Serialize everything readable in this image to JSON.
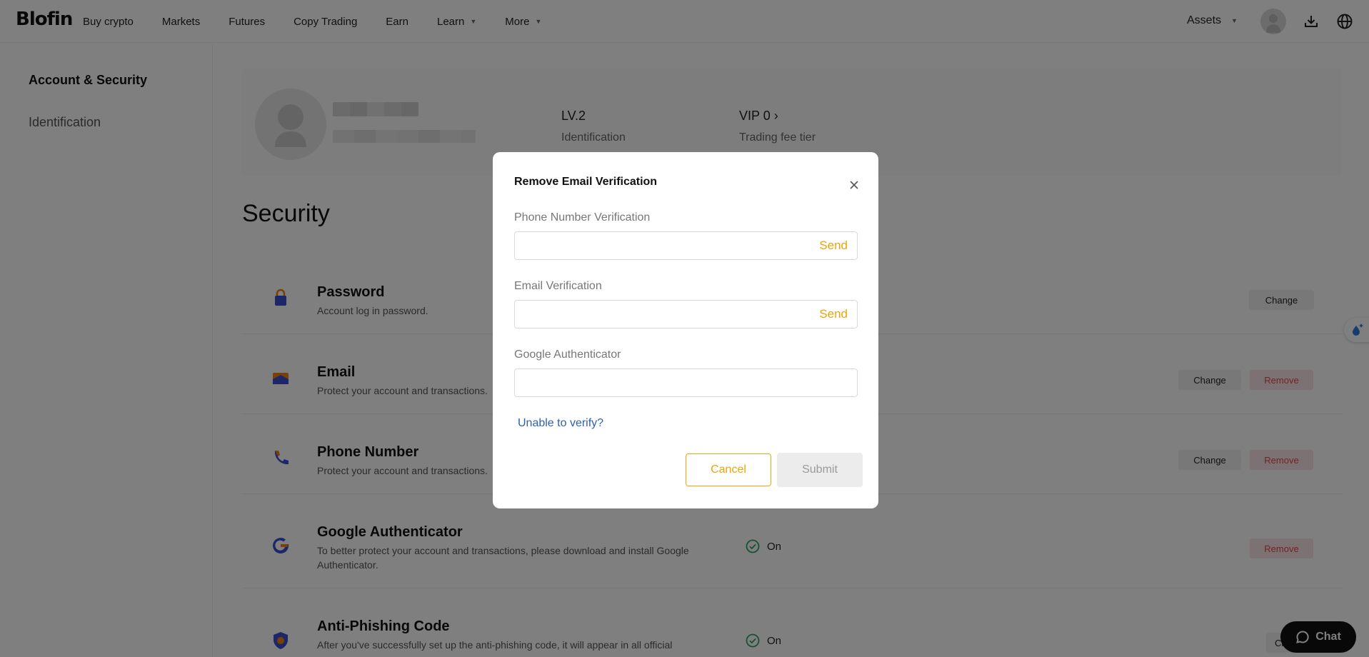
{
  "nav": {
    "logo": "Blofin",
    "links": [
      "Buy crypto",
      "Markets",
      "Futures",
      "Copy Trading",
      "Earn"
    ],
    "learn": "Learn",
    "more": "More",
    "assets": "Assets"
  },
  "sidebar": {
    "items": [
      {
        "label": "Account & Security"
      },
      {
        "label": "Identification"
      }
    ]
  },
  "profile": {
    "level_value": "LV.2",
    "level_label": "Identification",
    "vip_value": "VIP 0",
    "vip_label": "Trading fee tier"
  },
  "security": {
    "title": "Security",
    "rows": [
      {
        "title": "Password",
        "desc": "Account log in password.",
        "change": "Change"
      },
      {
        "title": "Email",
        "desc": "Protect your account and transactions.",
        "change": "Change",
        "remove": "Remove"
      },
      {
        "title": "Phone Number",
        "desc": "Protect your account and transactions.",
        "change": "Change",
        "remove": "Remove"
      },
      {
        "title": "Google Authenticator",
        "desc": "To better protect your account and transactions, please download and install Google Authenticator.",
        "status": "On",
        "remove": "Remove"
      },
      {
        "title": "Anti-Phishing Code",
        "desc": "After you've successfully set up the anti-phishing code, it will appear in all official",
        "status": "On",
        "change": "Cha"
      }
    ]
  },
  "chat": {
    "label": "Chat"
  },
  "modal": {
    "title": "Remove Email Verification",
    "phone_label": "Phone Number Verification",
    "phone_value": "",
    "email_label": "Email Verification",
    "email_value": "",
    "google_label": "Google Authenticator",
    "google_value": "",
    "send": "Send",
    "unable": "Unable to verify?",
    "cancel": "Cancel",
    "submit": "Submit"
  },
  "colors": {
    "accent": "#f0a30a",
    "link": "#2d5fb3",
    "remove": "#e0474f"
  }
}
